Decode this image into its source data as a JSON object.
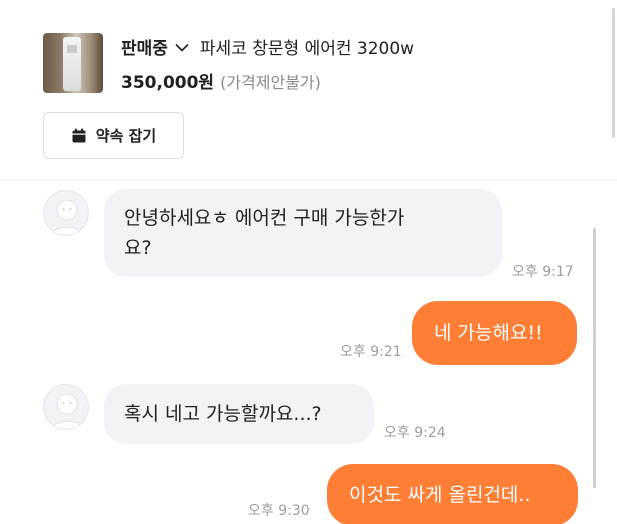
{
  "product": {
    "status": "판매중",
    "title": "파세코 창문형 에어컨 3200w",
    "price": "350,000원",
    "price_note": "(가격제안불가)",
    "appointment_button": "약속 잡기",
    "thumbnail_icon": "air-conditioner-photo"
  },
  "colors": {
    "accent": "#ff7e36",
    "incoming_bubble": "#f2f3f6"
  },
  "messages": [
    {
      "direction": "incoming",
      "line1": "안녕하세요ㅎ 에어컨 구매 가능한가",
      "line2": "요?",
      "time": "오후 9:17"
    },
    {
      "direction": "outgoing",
      "text": "네 가능해요!!",
      "time": "오후 9:21"
    },
    {
      "direction": "incoming",
      "text": "혹시 네고 가능할까요...?",
      "time": "오후 9:24"
    },
    {
      "direction": "outgoing",
      "text": "이것도 싸게 올린건데..",
      "time": "오후 9:30"
    }
  ]
}
